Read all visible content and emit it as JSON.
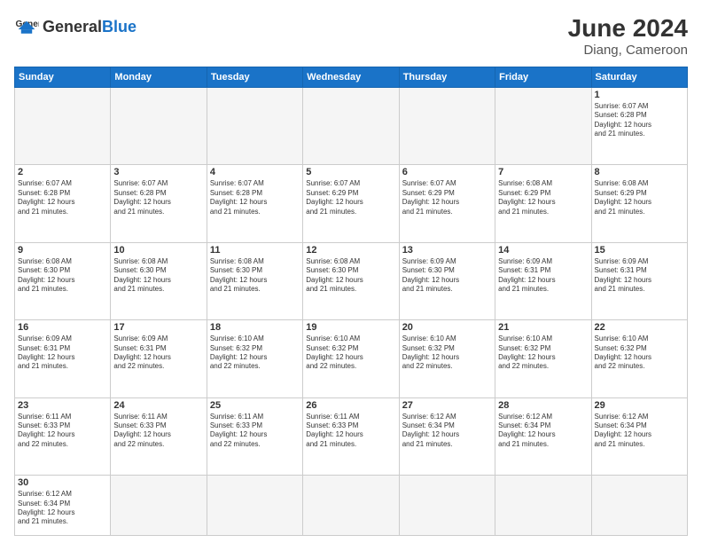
{
  "header": {
    "logo_general": "General",
    "logo_blue": "Blue",
    "title": "June 2024",
    "subtitle": "Diang, Cameroon"
  },
  "weekdays": [
    "Sunday",
    "Monday",
    "Tuesday",
    "Wednesday",
    "Thursday",
    "Friday",
    "Saturday"
  ],
  "weeks": [
    [
      {
        "day": "",
        "info": "",
        "empty": true
      },
      {
        "day": "",
        "info": "",
        "empty": true
      },
      {
        "day": "",
        "info": "",
        "empty": true
      },
      {
        "day": "",
        "info": "",
        "empty": true
      },
      {
        "day": "",
        "info": "",
        "empty": true
      },
      {
        "day": "",
        "info": "",
        "empty": true
      },
      {
        "day": "1",
        "info": "Sunrise: 6:07 AM\nSunset: 6:28 PM\nDaylight: 12 hours\nand 21 minutes."
      }
    ],
    [
      {
        "day": "2",
        "info": "Sunrise: 6:07 AM\nSunset: 6:28 PM\nDaylight: 12 hours\nand 21 minutes."
      },
      {
        "day": "3",
        "info": "Sunrise: 6:07 AM\nSunset: 6:28 PM\nDaylight: 12 hours\nand 21 minutes."
      },
      {
        "day": "4",
        "info": "Sunrise: 6:07 AM\nSunset: 6:28 PM\nDaylight: 12 hours\nand 21 minutes."
      },
      {
        "day": "5",
        "info": "Sunrise: 6:07 AM\nSunset: 6:29 PM\nDaylight: 12 hours\nand 21 minutes."
      },
      {
        "day": "6",
        "info": "Sunrise: 6:07 AM\nSunset: 6:29 PM\nDaylight: 12 hours\nand 21 minutes."
      },
      {
        "day": "7",
        "info": "Sunrise: 6:08 AM\nSunset: 6:29 PM\nDaylight: 12 hours\nand 21 minutes."
      },
      {
        "day": "8",
        "info": "Sunrise: 6:08 AM\nSunset: 6:29 PM\nDaylight: 12 hours\nand 21 minutes."
      }
    ],
    [
      {
        "day": "9",
        "info": "Sunrise: 6:08 AM\nSunset: 6:30 PM\nDaylight: 12 hours\nand 21 minutes."
      },
      {
        "day": "10",
        "info": "Sunrise: 6:08 AM\nSunset: 6:30 PM\nDaylight: 12 hours\nand 21 minutes."
      },
      {
        "day": "11",
        "info": "Sunrise: 6:08 AM\nSunset: 6:30 PM\nDaylight: 12 hours\nand 21 minutes."
      },
      {
        "day": "12",
        "info": "Sunrise: 6:08 AM\nSunset: 6:30 PM\nDaylight: 12 hours\nand 21 minutes."
      },
      {
        "day": "13",
        "info": "Sunrise: 6:09 AM\nSunset: 6:30 PM\nDaylight: 12 hours\nand 21 minutes."
      },
      {
        "day": "14",
        "info": "Sunrise: 6:09 AM\nSunset: 6:31 PM\nDaylight: 12 hours\nand 21 minutes."
      },
      {
        "day": "15",
        "info": "Sunrise: 6:09 AM\nSunset: 6:31 PM\nDaylight: 12 hours\nand 21 minutes."
      }
    ],
    [
      {
        "day": "16",
        "info": "Sunrise: 6:09 AM\nSunset: 6:31 PM\nDaylight: 12 hours\nand 21 minutes."
      },
      {
        "day": "17",
        "info": "Sunrise: 6:09 AM\nSunset: 6:31 PM\nDaylight: 12 hours\nand 22 minutes."
      },
      {
        "day": "18",
        "info": "Sunrise: 6:10 AM\nSunset: 6:32 PM\nDaylight: 12 hours\nand 22 minutes."
      },
      {
        "day": "19",
        "info": "Sunrise: 6:10 AM\nSunset: 6:32 PM\nDaylight: 12 hours\nand 22 minutes."
      },
      {
        "day": "20",
        "info": "Sunrise: 6:10 AM\nSunset: 6:32 PM\nDaylight: 12 hours\nand 22 minutes."
      },
      {
        "day": "21",
        "info": "Sunrise: 6:10 AM\nSunset: 6:32 PM\nDaylight: 12 hours\nand 22 minutes."
      },
      {
        "day": "22",
        "info": "Sunrise: 6:10 AM\nSunset: 6:32 PM\nDaylight: 12 hours\nand 22 minutes."
      }
    ],
    [
      {
        "day": "23",
        "info": "Sunrise: 6:11 AM\nSunset: 6:33 PM\nDaylight: 12 hours\nand 22 minutes."
      },
      {
        "day": "24",
        "info": "Sunrise: 6:11 AM\nSunset: 6:33 PM\nDaylight: 12 hours\nand 22 minutes."
      },
      {
        "day": "25",
        "info": "Sunrise: 6:11 AM\nSunset: 6:33 PM\nDaylight: 12 hours\nand 22 minutes."
      },
      {
        "day": "26",
        "info": "Sunrise: 6:11 AM\nSunset: 6:33 PM\nDaylight: 12 hours\nand 21 minutes."
      },
      {
        "day": "27",
        "info": "Sunrise: 6:12 AM\nSunset: 6:34 PM\nDaylight: 12 hours\nand 21 minutes."
      },
      {
        "day": "28",
        "info": "Sunrise: 6:12 AM\nSunset: 6:34 PM\nDaylight: 12 hours\nand 21 minutes."
      },
      {
        "day": "29",
        "info": "Sunrise: 6:12 AM\nSunset: 6:34 PM\nDaylight: 12 hours\nand 21 minutes."
      }
    ],
    [
      {
        "day": "30",
        "info": "Sunrise: 6:12 AM\nSunset: 6:34 PM\nDaylight: 12 hours\nand 21 minutes.",
        "last": true
      },
      {
        "day": "",
        "info": "",
        "empty": true,
        "last": true
      },
      {
        "day": "",
        "info": "",
        "empty": true,
        "last": true
      },
      {
        "day": "",
        "info": "",
        "empty": true,
        "last": true
      },
      {
        "day": "",
        "info": "",
        "empty": true,
        "last": true
      },
      {
        "day": "",
        "info": "",
        "empty": true,
        "last": true
      },
      {
        "day": "",
        "info": "",
        "empty": true,
        "last": true
      }
    ]
  ]
}
